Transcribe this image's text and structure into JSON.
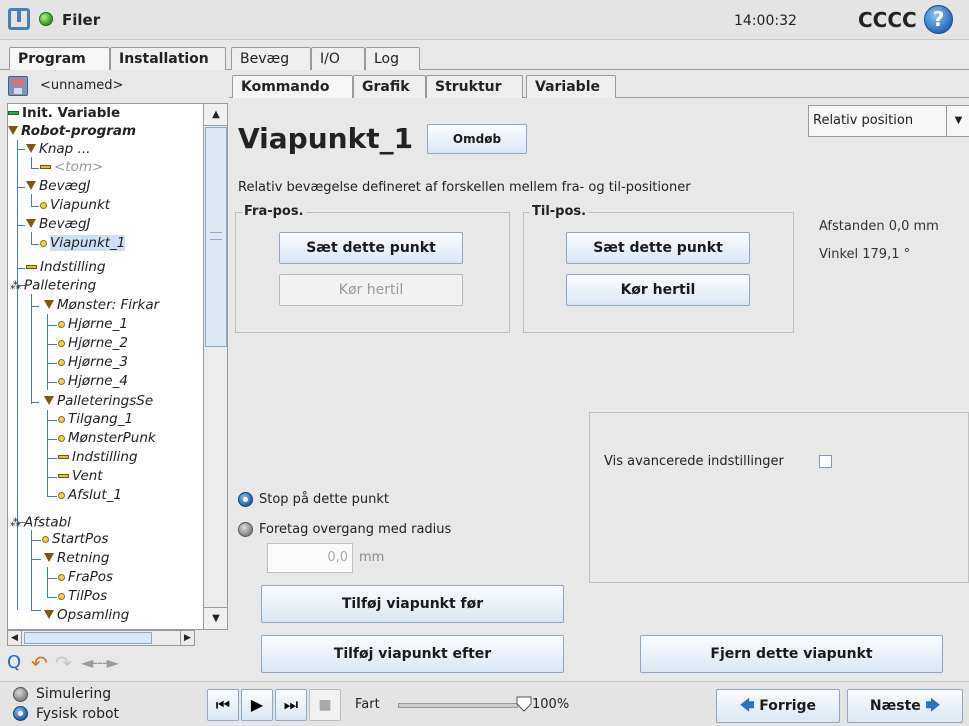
{
  "app": {
    "title": "Filer",
    "clock": "14:00:32",
    "robot_name": "CCCC",
    "help_icon": "?"
  },
  "main_tabs": [
    {
      "label": "Program",
      "active": true
    },
    {
      "label": "Installation"
    },
    {
      "label": "Bevæg"
    },
    {
      "label": "I/O"
    },
    {
      "label": "Log"
    }
  ],
  "program": {
    "name": "<unnamed>"
  },
  "tree": {
    "items": [
      {
        "label": "Init. Variable",
        "icon": "dash-green-icon"
      },
      {
        "label": "Robot-program",
        "icon": "triangle-icon"
      },
      {
        "label": "Knap ...",
        "icon": "triangle-icon"
      },
      {
        "label": "<tom>",
        "icon": "dash-yellow-icon"
      },
      {
        "label": "BevægJ",
        "icon": "triangle-icon"
      },
      {
        "label": "Viapunkt",
        "icon": "dot-icon"
      },
      {
        "label": "BevægJ",
        "icon": "triangle-icon"
      },
      {
        "label": "Viapunkt_1",
        "icon": "dot-icon"
      },
      {
        "label": "Indstilling",
        "icon": "dash-yellow-icon"
      },
      {
        "label": "Palletering",
        "icon": "pallet-icon"
      },
      {
        "label": "Mønster: Firkar",
        "icon": "triangle-icon"
      },
      {
        "label": "Hjørne_1",
        "icon": "dot-icon"
      },
      {
        "label": "Hjørne_2",
        "icon": "dot-icon"
      },
      {
        "label": "Hjørne_3",
        "icon": "dot-icon"
      },
      {
        "label": "Hjørne_4",
        "icon": "dot-icon"
      },
      {
        "label": "PalleteringsSe",
        "icon": "triangle-icon"
      },
      {
        "label": "Tilgang_1",
        "icon": "dot-icon"
      },
      {
        "label": "MønsterPunk",
        "icon": "dot-icon"
      },
      {
        "label": "Indstilling",
        "icon": "dash-yellow-icon"
      },
      {
        "label": "Vent",
        "icon": "dash-yellow-icon"
      },
      {
        "label": "Afslut_1",
        "icon": "dot-icon"
      },
      {
        "label": "Afstabl",
        "icon": "pallet-icon"
      },
      {
        "label": "StartPos",
        "icon": "dot-icon"
      },
      {
        "label": "Retning",
        "icon": "triangle-icon"
      },
      {
        "label": "FraPos",
        "icon": "dot-icon"
      },
      {
        "label": "TilPos",
        "icon": "dot-icon"
      },
      {
        "label": "Opsamling",
        "icon": "triangle-icon"
      }
    ],
    "toolbar": {
      "search_icon": "Q",
      "undo_icon": "↶",
      "redo_icon": "↷",
      "cut_icon": "◄---►"
    }
  },
  "command_tabs": [
    {
      "label": "Kommando",
      "active": true
    },
    {
      "label": "Grafik"
    },
    {
      "label": "Struktur"
    },
    {
      "label": "Variable"
    }
  ],
  "waypoint": {
    "title": "Viapunkt_1",
    "rename_label": "Omdøb",
    "position_type": "Relativ position",
    "description": "Relativ bevægelse defineret af forskellen mellem fra- og til-positioner",
    "fra": {
      "label": "Fra-pos.",
      "set_label": "Sæt dette punkt",
      "goto_label": "Kør hertil"
    },
    "til": {
      "label": "Til-pos.",
      "set_label": "Sæt dette punkt",
      "goto_label": "Kør hertil"
    },
    "distance": "Afstanden 0,0 mm",
    "angle": "Vinkel 179,1 °",
    "advanced_label": "Vis avancerede indstillinger",
    "stop_label": "Stop på dette punkt",
    "blend_label": "Foretag overgang med radius",
    "radius_value": "0,0",
    "radius_unit": "mm",
    "add_before_label": "Tilføj viapunkt før",
    "add_after_label": "Tilføj viapunkt efter",
    "remove_label": "Fjern dette viapunkt"
  },
  "bottom": {
    "simulation_label": "Simulering",
    "real_robot_label": "Fysisk robot",
    "speed_label": "Fart",
    "speed_value": "100%",
    "speed_percent": 100,
    "prev_label": "Forrige",
    "next_label": "Næste"
  }
}
